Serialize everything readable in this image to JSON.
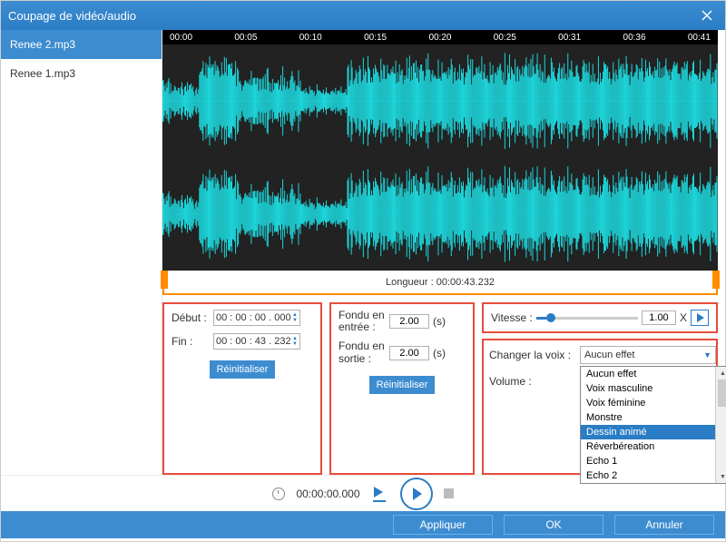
{
  "title": "Coupage de vidéo/audio",
  "sidebar": {
    "items": [
      {
        "label": "Renee 2.mp3",
        "active": true
      },
      {
        "label": "Renee 1.mp3",
        "active": false
      }
    ]
  },
  "timeline": {
    "ticks": [
      "00:00",
      "00:05",
      "00:10",
      "00:15",
      "00:20",
      "00:25",
      "00:31",
      "00:36",
      "00:41"
    ]
  },
  "selection": {
    "length_label": "Longueur : 00:00:43.232"
  },
  "time_range": {
    "debut_label": "Début :",
    "debut_value": "00 : 00 : 00 . 000",
    "fin_label": "Fin :",
    "fin_value": "00 : 00 : 43 . 232",
    "reset_label": "Réinitialiser"
  },
  "fade": {
    "in_label": "Fondu en entrée :",
    "in_value": "2.00",
    "out_label": "Fondu en sortie :",
    "out_value": "2.00",
    "seconds_suffix": "(s)",
    "reset_label": "Réinitialiser"
  },
  "speed": {
    "label": "Vitesse :",
    "value": "1.00",
    "suffix": "X",
    "slider_pct": 10
  },
  "voice": {
    "label": "Changer la voix :",
    "selected": "Aucun effet",
    "options": [
      "Aucun effet",
      "Voix masculine",
      "Voix féminine",
      "Monstre",
      "Dessin animé",
      "Réverbéreation",
      "Echo 1",
      "Echo 2"
    ],
    "highlighted_index": 4
  },
  "volume": {
    "label": "Volume :",
    "percent_suffix": "%"
  },
  "playback": {
    "timecode": "00:00:00.000"
  },
  "footer": {
    "apply_label": "Appliquer",
    "ok_label": "OK",
    "cancel_label": "Annuler"
  }
}
